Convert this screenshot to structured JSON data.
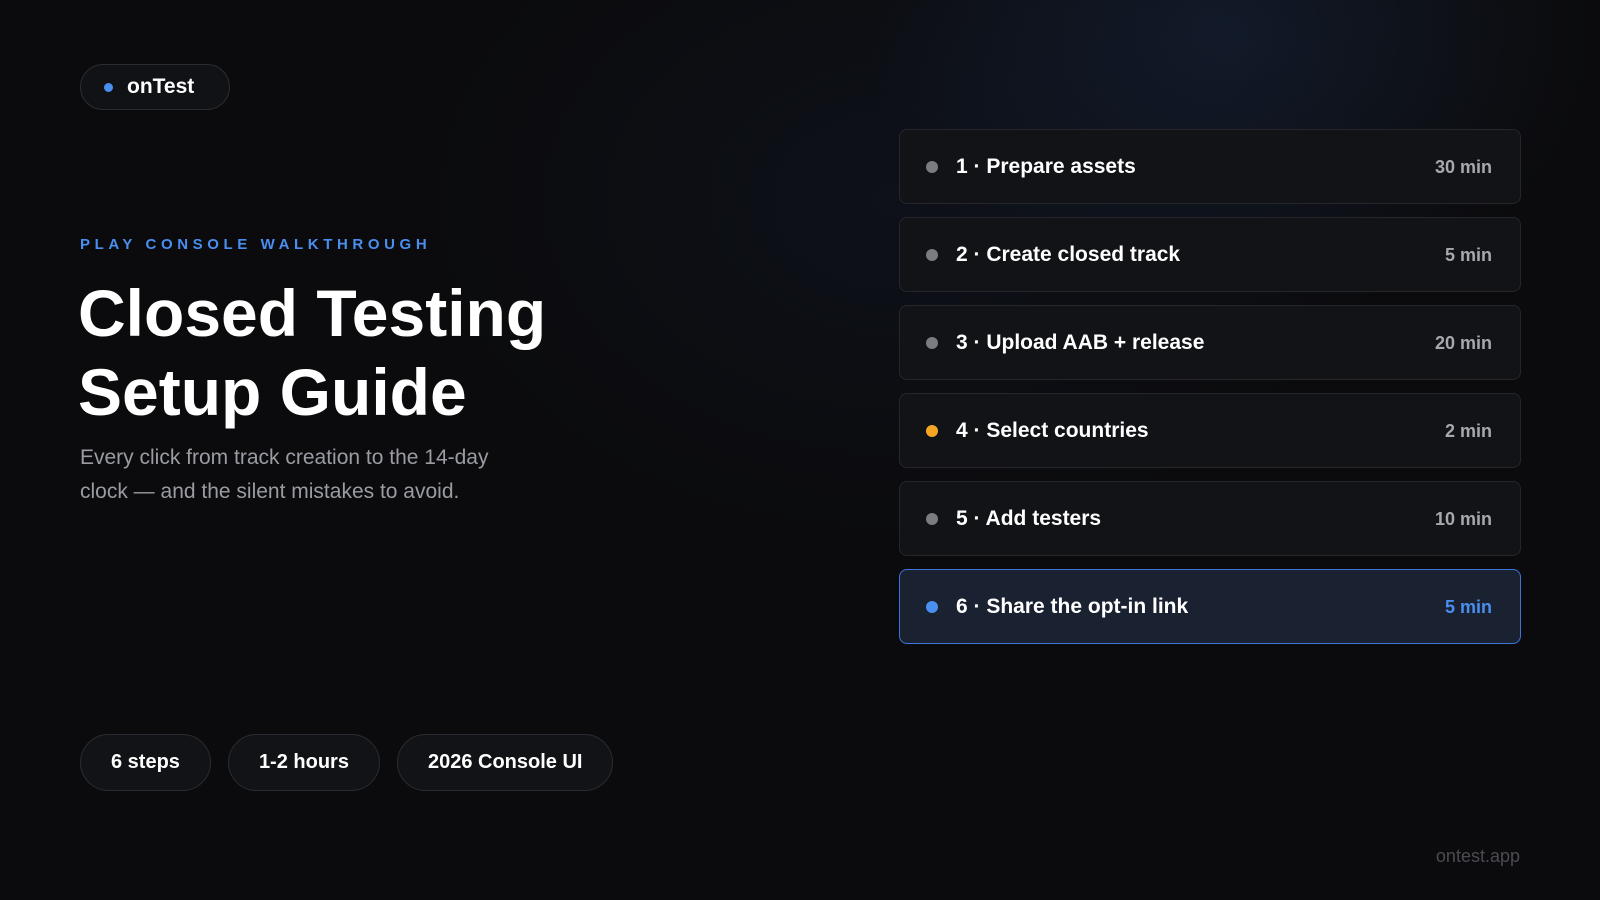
{
  "brand": {
    "name": "onTest",
    "dot_color": "#4a8ef0"
  },
  "hero": {
    "eyebrow": "PLAY CONSOLE WALKTHROUGH",
    "title_line1": "Closed Testing",
    "title_line2": "Setup Guide",
    "subtitle": "Every click from track creation to the 14-day clock — and the silent mistakes to avoid."
  },
  "steps": [
    {
      "label": "1 · Prepare assets",
      "time": "30 min",
      "dot_color": "#7a7c82",
      "active": false
    },
    {
      "label": "2 · Create closed track",
      "time": "5 min",
      "dot_color": "#7a7c82",
      "active": false
    },
    {
      "label": "3 · Upload AAB + release",
      "time": "20 min",
      "dot_color": "#7a7c82",
      "active": false
    },
    {
      "label": "4 · Select countries",
      "time": "2 min",
      "dot_color": "#f5a623",
      "active": false
    },
    {
      "label": "5 · Add testers",
      "time": "10 min",
      "dot_color": "#7a7c82",
      "active": false
    },
    {
      "label": "6 · Share the opt-in link",
      "time": "5 min",
      "dot_color": "#4a8ef0",
      "active": true
    }
  ],
  "tags": [
    "6 steps",
    "1-2 hours",
    "2026 Console UI"
  ],
  "footer": {
    "url": "ontest.app"
  },
  "colors": {
    "accent": "#4a8ef0",
    "warning": "#f5a623",
    "background": "#0b0b0d"
  }
}
